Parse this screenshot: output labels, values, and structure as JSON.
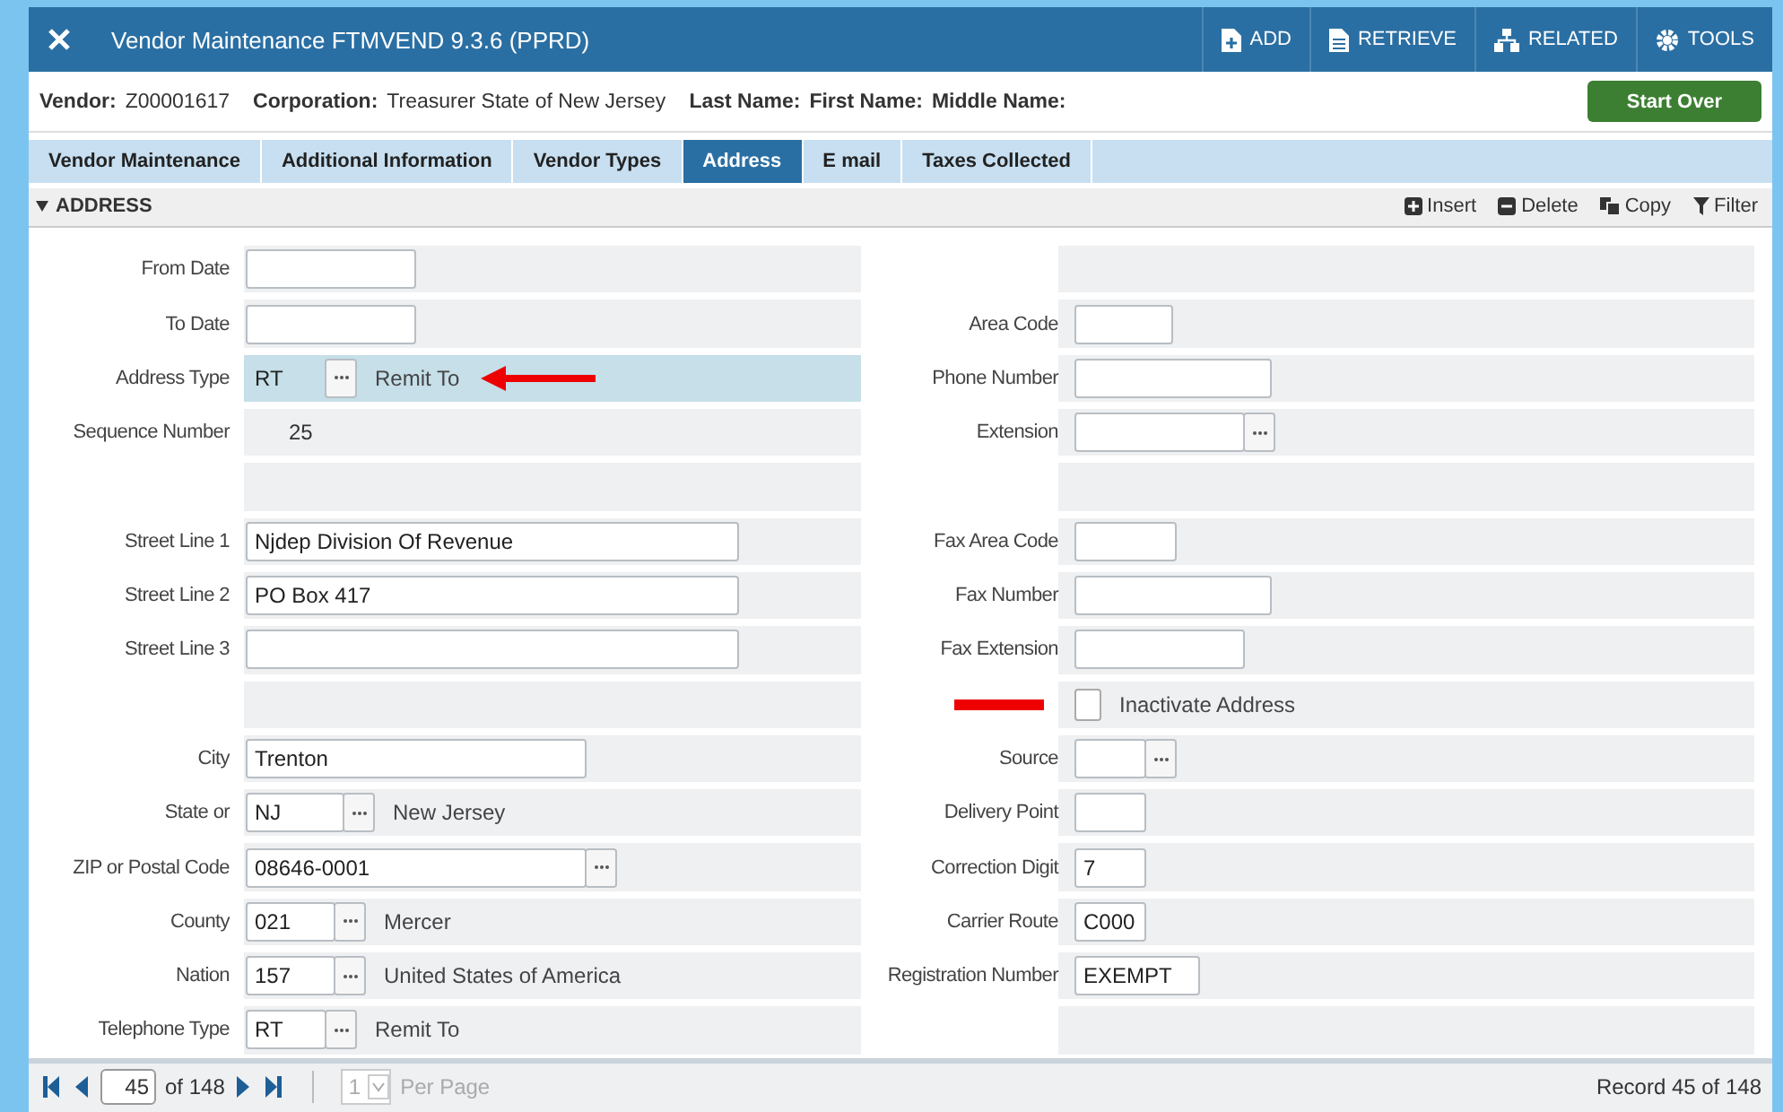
{
  "header": {
    "title": "Vendor Maintenance FTMVEND 9.3.6 (PPRD)",
    "actions": [
      {
        "kind": "add",
        "label": "ADD"
      },
      {
        "kind": "retrieve",
        "label": "RETRIEVE"
      },
      {
        "kind": "related",
        "label": "RELATED"
      },
      {
        "kind": "tools",
        "label": "TOOLS"
      }
    ]
  },
  "key_block": {
    "items": [
      {
        "label": "Vendor:",
        "value": "Z00001617"
      },
      {
        "label": "Corporation:",
        "value": "Treasurer State of New Jersey"
      },
      {
        "label": "Last Name:"
      },
      {
        "label": "First Name:"
      },
      {
        "label": "Middle Name:"
      }
    ],
    "start_over": "Start Over"
  },
  "tabs": [
    {
      "label": "Vendor Maintenance",
      "selected": false
    },
    {
      "label": "Additional Information",
      "selected": false
    },
    {
      "label": "Vendor Types",
      "selected": false
    },
    {
      "label": "Address",
      "selected": true
    },
    {
      "label": "E mail",
      "selected": false
    },
    {
      "label": "Taxes Collected",
      "selected": false
    }
  ],
  "section": {
    "title": "ADDRESS",
    "tools": [
      {
        "kind": "insert",
        "label": "Insert"
      },
      {
        "kind": "delete",
        "label": "Delete"
      },
      {
        "kind": "copy",
        "label": "Copy"
      },
      {
        "kind": "filter",
        "label": "Filter"
      }
    ]
  },
  "left_fields": [
    {
      "kind": "input",
      "label": "From Date",
      "current": false,
      "marked": false
    },
    {
      "kind": "input",
      "label": "To Date",
      "current": false,
      "marked": false
    },
    {
      "kind": "lookup",
      "label": "Address Type",
      "value": "RT",
      "description": "Remit To",
      "current": true,
      "marked": true
    },
    {
      "kind": "display",
      "label": "Sequence Number",
      "value": "25",
      "current": false,
      "marked": false
    },
    {
      "kind": "blank",
      "current": false,
      "marked": false
    },
    {
      "kind": "input",
      "label": "Street Line 1",
      "value": "Njdep Division Of Revenue",
      "current": false,
      "marked": false
    },
    {
      "kind": "input",
      "label": "Street Line 2",
      "value": "PO Box 417",
      "current": false,
      "marked": false
    },
    {
      "kind": "input",
      "label": "Street Line 3",
      "current": false,
      "marked": false
    },
    {
      "kind": "blank",
      "current": false,
      "marked": false
    },
    {
      "kind": "input",
      "label": "City",
      "value": "Trenton",
      "current": false,
      "marked": false
    },
    {
      "kind": "lookup",
      "label": "State or",
      "value": "NJ",
      "description": "New Jersey",
      "current": false,
      "marked": false
    },
    {
      "kind": "lookup",
      "label": "ZIP or Postal Code",
      "value": "08646-0001",
      "current": false,
      "marked": false
    },
    {
      "kind": "lookup",
      "label": "County",
      "value": "021",
      "description": "Mercer",
      "current": false,
      "marked": false
    },
    {
      "kind": "lookup",
      "label": "Nation",
      "value": "157",
      "description": "United States of America",
      "current": false,
      "marked": false
    },
    {
      "kind": "lookup",
      "label": "Telephone Type",
      "value": "RT",
      "description": "Remit To",
      "current": false,
      "marked": false
    }
  ],
  "right_fields": [
    {
      "kind": "blank",
      "marked": false
    },
    {
      "kind": "input",
      "label": "Area Code",
      "marked": false
    },
    {
      "kind": "input",
      "label": "Phone Number",
      "marked": false
    },
    {
      "kind": "lookup",
      "label": "Extension",
      "marked": false
    },
    {
      "kind": "blank",
      "marked": false
    },
    {
      "kind": "input",
      "label": "Fax Area Code",
      "marked": false
    },
    {
      "kind": "input",
      "label": "Fax Number",
      "marked": false
    },
    {
      "kind": "input",
      "label": "Fax Extension",
      "marked": false
    },
    {
      "kind": "checkbox",
      "label": "Inactivate Address",
      "checked": false,
      "marked": true
    },
    {
      "kind": "lookup",
      "label": "Source",
      "marked": false
    },
    {
      "kind": "input",
      "label": "Delivery Point",
      "marked": false
    },
    {
      "kind": "input",
      "label": "Correction Digit",
      "value": "7",
      "marked": false
    },
    {
      "kind": "input",
      "label": "Carrier Route",
      "value": "C000",
      "marked": false
    },
    {
      "kind": "input",
      "label": "Registration Number",
      "value": "EXEMPT",
      "marked": false
    },
    {
      "kind": "blank",
      "marked": false
    }
  ],
  "footer": {
    "page": "45",
    "of_pages": "of 148",
    "per_page": "1",
    "per_page_label": "Per Page",
    "record": "Record 45 of 148"
  }
}
